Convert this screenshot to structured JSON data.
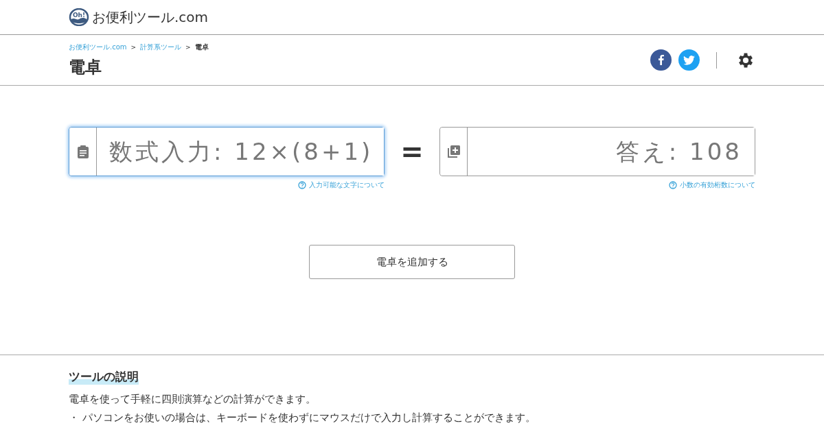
{
  "site_header": {
    "logo_mark": "Oh!",
    "site_name": "お便利ツール.com"
  },
  "breadcrumb": [
    {
      "label": "お便利ツール.com",
      "link": true
    },
    {
      "label": "計算系ツール",
      "link": true
    },
    {
      "label": "電卓",
      "link": false
    }
  ],
  "breadcrumb_separator": ">",
  "page_title": "電卓",
  "calculator": {
    "expression_field": {
      "placeholder": "数式入力: 12×(8+1)",
      "focused": true,
      "help_link": "入力可能な文字について"
    },
    "equals": "=",
    "answer_field": {
      "placeholder": "答え: 108",
      "focused": false,
      "help_link": "小数の有効桁数について"
    }
  },
  "add_button": "電卓を追加する",
  "description": {
    "heading": "ツールの説明",
    "lines": [
      "電卓を使って手軽に四則演算などの計算ができます。",
      "・ パソコンをお使いの場合は、キーボードを使わずにマウスだけで入力し計算することができます。"
    ]
  }
}
